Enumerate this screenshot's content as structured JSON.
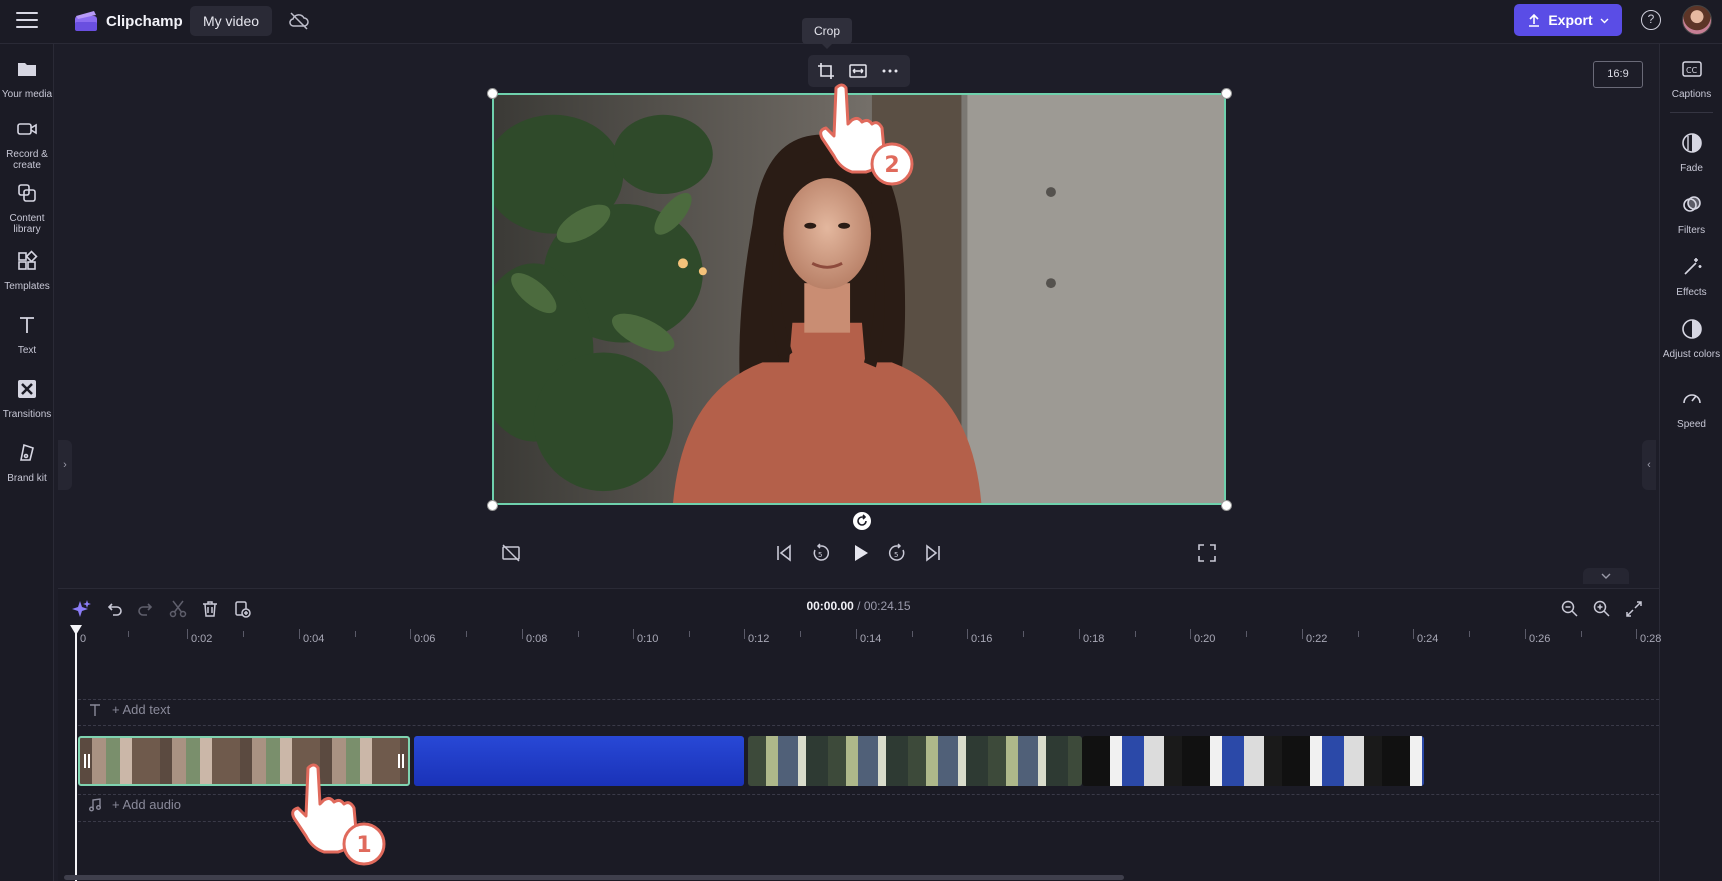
{
  "topbar": {
    "brand": "Clipchamp",
    "project_name": "My video",
    "export_label": "Export"
  },
  "left_sidebar": {
    "items": [
      {
        "label": "Your media",
        "icon": "folder-icon"
      },
      {
        "label": "Record & create",
        "icon": "camera-icon"
      },
      {
        "label": "Content library",
        "icon": "library-icon"
      },
      {
        "label": "Templates",
        "icon": "templates-icon"
      },
      {
        "label": "Text",
        "icon": "text-icon"
      },
      {
        "label": "Transitions",
        "icon": "transitions-icon"
      },
      {
        "label": "Brand kit",
        "icon": "brand-kit-icon"
      }
    ]
  },
  "right_sidebar": {
    "items": [
      {
        "label": "Captions",
        "icon": "captions-icon"
      },
      {
        "label": "Fade",
        "icon": "fade-icon"
      },
      {
        "label": "Filters",
        "icon": "filters-icon"
      },
      {
        "label": "Effects",
        "icon": "effects-icon"
      },
      {
        "label": "Adjust colors",
        "icon": "adjust-colors-icon"
      },
      {
        "label": "Speed",
        "icon": "speed-icon"
      }
    ]
  },
  "preview": {
    "tooltip": "Crop",
    "aspect_ratio": "16:9"
  },
  "timeline": {
    "current_time": "00:00.00",
    "separator": " / ",
    "total_time": "00:24.15",
    "ruler_labels": [
      "0",
      "0:02",
      "0:04",
      "0:06",
      "0:08",
      "0:10",
      "0:12",
      "0:14",
      "0:16",
      "0:18",
      "0:20",
      "0:22",
      "0:24",
      "0:26",
      "0:28"
    ],
    "add_text_label": "+ Add text",
    "add_audio_label": "+ Add audio"
  },
  "annotations": {
    "step1": "1",
    "step2": "2"
  },
  "colors": {
    "accent": "#5a4de6",
    "selection": "#6fd1ad",
    "step_badge": "#e06a5c"
  }
}
